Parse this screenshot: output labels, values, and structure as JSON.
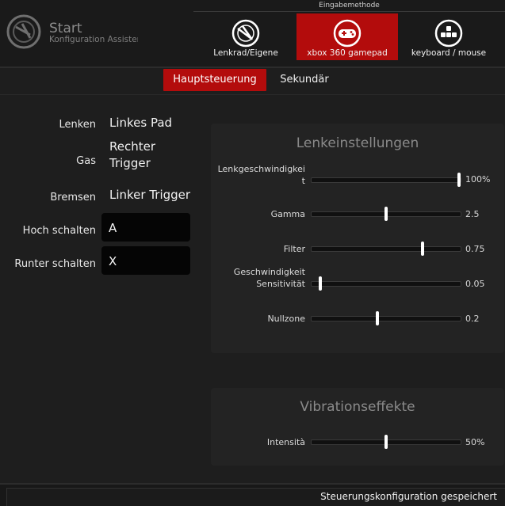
{
  "app": {
    "title": "Start",
    "subtitle": "Konfiguration Assistent"
  },
  "input_method": {
    "caption": "Eingabemethode",
    "modes": [
      {
        "label": "Lenkrad/Eigene",
        "icon": "steering-wheel-icon",
        "active": false
      },
      {
        "label": "xbox 360 gamepad",
        "icon": "gamepad-icon",
        "active": true
      },
      {
        "label": "keyboard / mouse",
        "icon": "keyboard-keys-icon",
        "active": false
      }
    ]
  },
  "tabs": [
    {
      "label": "Hauptsteuerung",
      "active": true
    },
    {
      "label": "Sekundär",
      "active": false
    }
  ],
  "mappings": {
    "steer": {
      "label": "Lenken",
      "value": "Linkes Pad"
    },
    "gas": {
      "label": "Gas",
      "value_line1": "Rechter",
      "value_line2": "Trigger"
    },
    "brake": {
      "label": "Bremsen",
      "value": "Linker Trigger"
    },
    "shift_up": {
      "label": "Hoch schalten",
      "value": "A"
    },
    "shift_down": {
      "label": "Runter schalten",
      "value": "X"
    }
  },
  "steering_settings": {
    "title": "Lenkeinstellungen",
    "sliders": [
      {
        "label_line1": "Lenkgeschwindigkei",
        "label_line2": "t",
        "value": 1.0,
        "value_text": "100%"
      },
      {
        "label_line1": "Gamma",
        "label_line2": "",
        "value": 0.5,
        "value_text": "2.5"
      },
      {
        "label_line1": "Filter",
        "label_line2": "",
        "value": 0.75,
        "value_text": "0.75"
      },
      {
        "label_line1": "Geschwindigkeit",
        "label_line2": "Sensitivität",
        "value": 0.05,
        "value_text": "0.05"
      },
      {
        "label_line1": "Nullzone",
        "label_line2": "",
        "value": 0.44,
        "value_text": "0.2"
      }
    ]
  },
  "vibration": {
    "title": "Vibrationseffekte",
    "sliders": [
      {
        "label_line1": "Intensità",
        "label_line2": "",
        "value": 0.5,
        "value_text": "50%"
      }
    ]
  },
  "status": {
    "text": "Steuerungskonfiguration gespeichert"
  },
  "colors": {
    "accent": "#b30c0c",
    "background": "#1e1e1e",
    "panel": "#232323"
  }
}
